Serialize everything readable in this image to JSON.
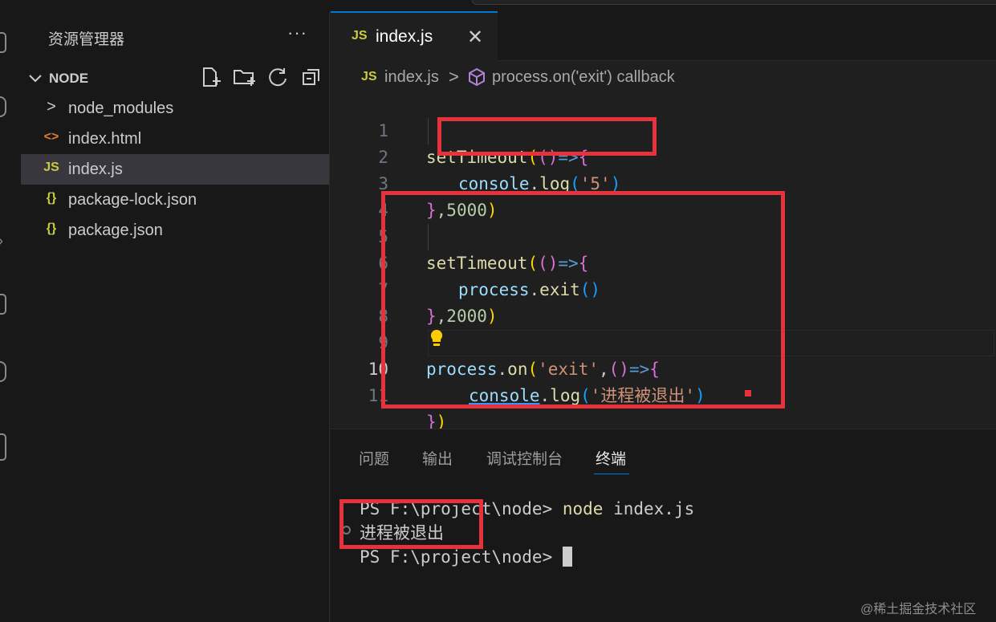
{
  "explorer": {
    "title": "资源管理器",
    "more": "···",
    "folder": "NODE",
    "items": [
      {
        "icon": ">",
        "label": "node_modules",
        "type": "folder"
      },
      {
        "icon": "<>",
        "label": "index.html",
        "type": "html"
      },
      {
        "icon": "JS",
        "label": "index.js",
        "type": "js",
        "selected": true
      },
      {
        "icon": "{}",
        "label": "package-lock.json",
        "type": "json"
      },
      {
        "icon": "{}",
        "label": "package.json",
        "type": "json"
      }
    ]
  },
  "editor": {
    "tab": {
      "icon": "JS",
      "name": "index.js",
      "close": "✕"
    },
    "breadcrumb": {
      "icon": "JS",
      "file": "index.js",
      "separator": ">",
      "symbol": "process.on('exit') callback"
    },
    "line_numbers": [
      "1",
      "2",
      "3",
      "4",
      "5",
      "6",
      "7",
      "8",
      "9",
      "10",
      "11"
    ],
    "active_line": "10",
    "code": {
      "l1_fn": "setTimeout",
      "l1_open": "(",
      "l1_args": "()",
      "l1_arrow": "=>",
      "l1_brace": "{",
      "l2_obj": "console",
      "l2_dot": ".",
      "l2_fn": "log",
      "l2_open": "(",
      "l2_str": "'5'",
      "l2_close": ")",
      "l3_brace": "}",
      "l3_num": ",5000",
      "l3_close": ")",
      "l5_fn": "setTimeout",
      "l5_open": "(",
      "l5_args": "()",
      "l5_arrow": "=>",
      "l5_brace": "{",
      "l6_obj": "process",
      "l6_dot": ".",
      "l6_fn": "exit",
      "l6_args": "()",
      "l7_brace": "}",
      "l7_num": ",2000",
      "l7_close": ")",
      "l9_obj": "process",
      "l9_dot": ".",
      "l9_fn": "on",
      "l9_open": "(",
      "l9_str": "'exit'",
      "l9_comma": ",",
      "l9_args": "()",
      "l9_arrow": "=>",
      "l9_brace": "{",
      "l10_obj": "console",
      "l10_dot": ".",
      "l10_fn": "log",
      "l10_open": "(",
      "l10_str": "'进程被退出'",
      "l10_close": ")",
      "l11_brace": "}",
      "l11_close": ")"
    }
  },
  "panel": {
    "tabs": [
      "问题",
      "输出",
      "调试控制台",
      "终端"
    ],
    "active_tab": "终端",
    "terminal": {
      "prompt1": "PS F:\\project\\node> ",
      "command": "node",
      "command_args": " index.js",
      "output": "进程被退出",
      "prompt2": "PS F:\\project\\node> "
    }
  },
  "watermark": "@稀土掘金技术社区",
  "colors": {
    "highlight_box": "#e5323b",
    "accent": "#0078d4",
    "js_icon": "#cbcb41",
    "html_icon": "#e37933"
  }
}
